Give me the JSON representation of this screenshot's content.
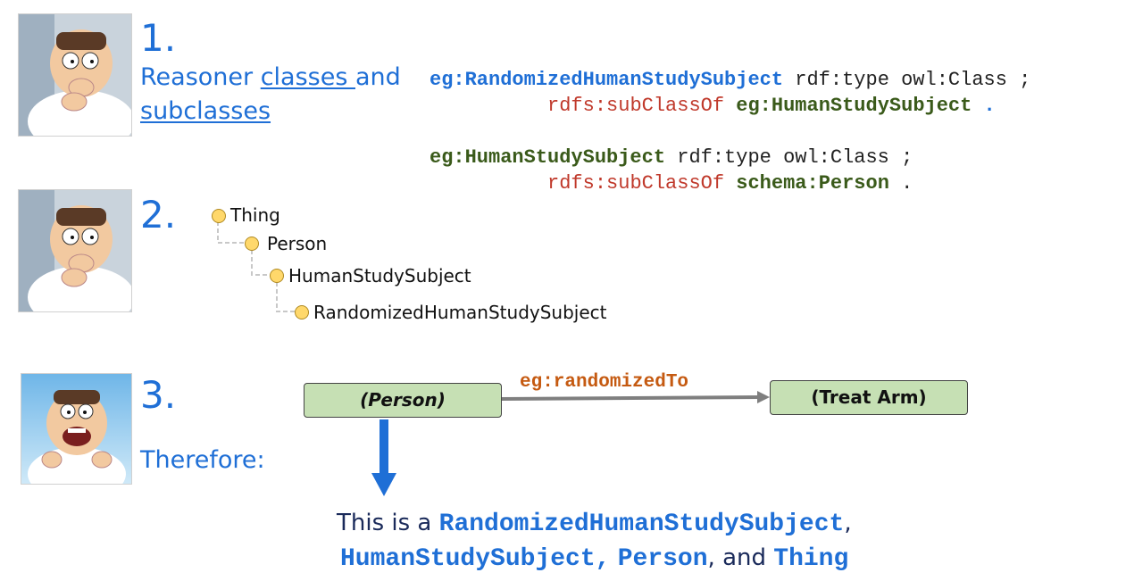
{
  "step1": {
    "number": "1.",
    "text_part1": "Reasoner ",
    "text_link1": "classes ",
    "text_part2": "and",
    "text_link2": "subclasses"
  },
  "code": {
    "line1_subject": "eg:RandomizedHumanStudySubject",
    "line1_rest": " rdf:type owl:Class ;",
    "line2_pred": "rdfs:subClassOf",
    "line2_obj": "eg:HumanStudySubject",
    "line2_end": " .",
    "line3_subject": "eg:HumanStudySubject",
    "line3_rest": " rdf:type owl:Class ;",
    "line4_pred": "rdfs:subClassOf",
    "line4_obj": "schema:Person",
    "line4_end": " ."
  },
  "step2": {
    "number": "2.",
    "tree": [
      "Thing",
      "Person",
      "HumanStudySubject",
      "RandomizedHumanStudySubject"
    ]
  },
  "step3": {
    "number": "3.",
    "therefore": "Therefore:",
    "node_person": "(Person)",
    "node_treat": "(Treat Arm)",
    "edge_label": "eg:randomizedTo"
  },
  "conclusion": {
    "prefix": "This is a ",
    "c1": "RandomizedHumanStudySubject",
    "sep1": ",",
    "c2": "HumanStudySubject,",
    "c3": "Person",
    "sep2": ", and ",
    "c4": "Thing"
  },
  "colors": {
    "accent_blue": "#1f6fd6",
    "code_red": "#c0392b",
    "code_green": "#3a5a1a",
    "edge_orange": "#c55a11",
    "node_fill": "#c6e0b4",
    "tree_dot": "#ffd86b"
  },
  "icons": [
    "peter-thinking-icon",
    "peter-thinking-icon",
    "peter-laughing-icon"
  ]
}
